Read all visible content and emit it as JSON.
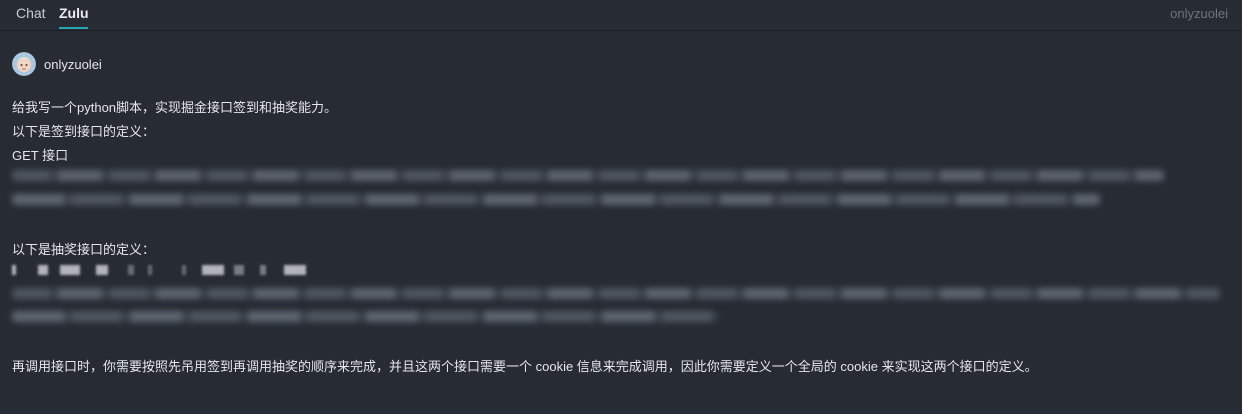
{
  "tabs": [
    {
      "label": "Chat"
    },
    {
      "label": "Zulu"
    }
  ],
  "header": {
    "user": "onlyzuolei"
  },
  "message": {
    "author": "onlyzuolei",
    "lines": [
      "给我写一个python脚本，实现掘金接口签到和抽奖能力。",
      "以下是签到接口的定义：",
      "GET 接口",
      "以下是抽奖接口的定义：",
      "再调用接口时，你需要按照先吊用签到再调用抽奖的顺序来完成，并且这两个接口需要一个 cookie 信息来完成调用，因此你需要定义一个全局的 cookie 来实现这两个接口的定义。"
    ]
  },
  "colors": {
    "background": "#272b33",
    "accent": "#2aa6b3"
  }
}
